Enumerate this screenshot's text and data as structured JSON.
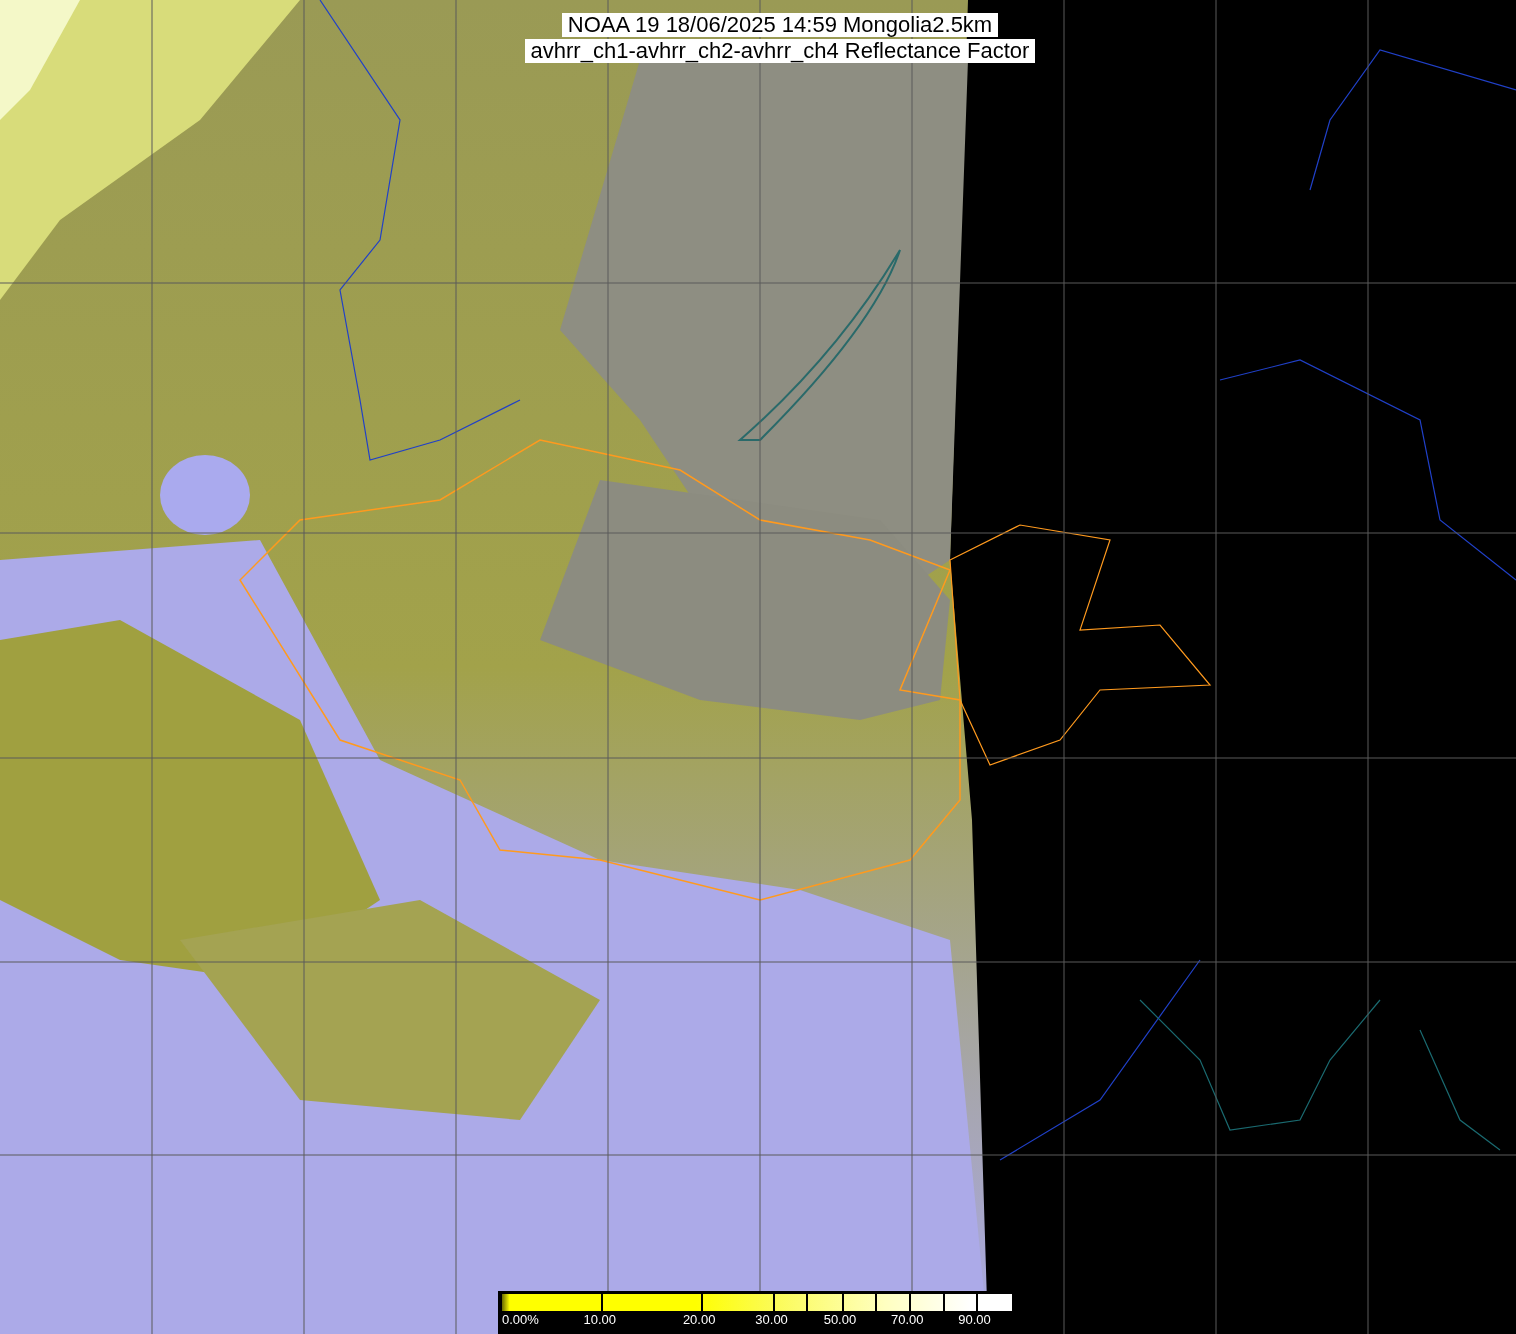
{
  "title": {
    "lines": [
      "NOAA 19 18/06/2025 14:59 Mongolia2.5km",
      "avhrr_ch1-avhrr_ch2-avhrr_ch4 Reflectance Factor"
    ]
  },
  "colorbar": {
    "labels": [
      "0.00%",
      "10.00",
      "20.00",
      "30.00",
      "50.00",
      "70.00",
      "90.00"
    ]
  }
}
